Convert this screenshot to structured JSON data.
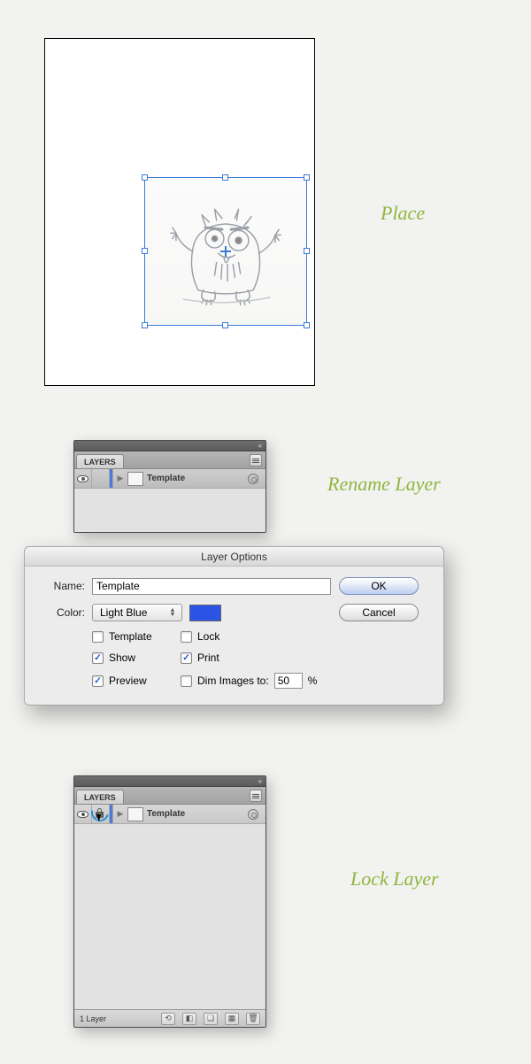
{
  "labels": {
    "place": "Place",
    "rename": "Rename Layer",
    "lock": "Lock Layer"
  },
  "panel": {
    "tab": "LAYERS",
    "layer_name": "Template",
    "footer_count": "1 Layer"
  },
  "dialog": {
    "title": "Layer Options",
    "name_label": "Name:",
    "name_value": "Template",
    "color_label": "Color:",
    "color_value": "Light Blue",
    "ok": "OK",
    "cancel": "Cancel",
    "template": "Template",
    "lock": "Lock",
    "show": "Show",
    "print": "Print",
    "preview": "Preview",
    "dim_label": "Dim Images to:",
    "dim_value": "50",
    "dim_pct": "%"
  }
}
